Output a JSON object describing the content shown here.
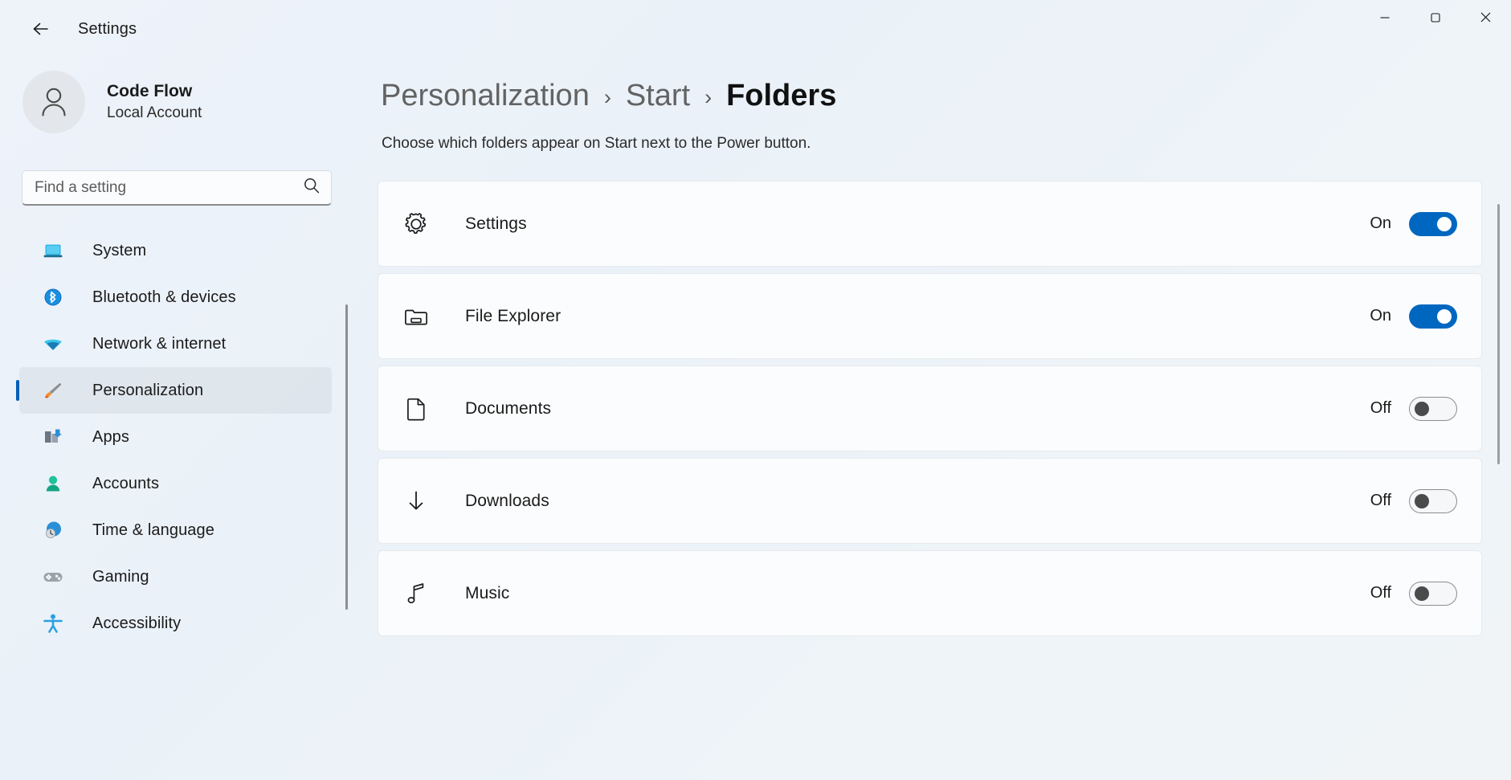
{
  "titlebar": {
    "app_title": "Settings",
    "back_icon": "arrow-left-icon",
    "minimize_icon": "minimize-icon",
    "maximize_icon": "maximize-icon",
    "close_icon": "close-icon"
  },
  "account": {
    "name": "Code Flow",
    "type": "Local Account",
    "avatar_icon": "person-icon"
  },
  "search": {
    "placeholder": "Find a setting",
    "value": "",
    "icon": "search-icon"
  },
  "sidebar": {
    "items": [
      {
        "label": "System",
        "icon": "laptop-icon",
        "selected": false
      },
      {
        "label": "Bluetooth & devices",
        "icon": "bluetooth-icon",
        "selected": false
      },
      {
        "label": "Network & internet",
        "icon": "wifi-icon",
        "selected": false
      },
      {
        "label": "Personalization",
        "icon": "paintbrush-icon",
        "selected": true
      },
      {
        "label": "Apps",
        "icon": "apps-icon",
        "selected": false
      },
      {
        "label": "Accounts",
        "icon": "account-icon",
        "selected": false
      },
      {
        "label": "Time & language",
        "icon": "clock-globe-icon",
        "selected": false
      },
      {
        "label": "Gaming",
        "icon": "gamepad-icon",
        "selected": false
      },
      {
        "label": "Accessibility",
        "icon": "accessibility-icon",
        "selected": false
      }
    ]
  },
  "main": {
    "breadcrumb": [
      {
        "label": "Personalization",
        "current": false
      },
      {
        "label": "Start",
        "current": false
      },
      {
        "label": "Folders",
        "current": true
      }
    ],
    "separator": "›",
    "description": "Choose which folders appear on Start next to the Power button.",
    "folders": [
      {
        "label": "Settings",
        "icon": "gear-icon",
        "state": "On",
        "on": true
      },
      {
        "label": "File Explorer",
        "icon": "folder-icon",
        "state": "On",
        "on": true
      },
      {
        "label": "Documents",
        "icon": "document-icon",
        "state": "Off",
        "on": false
      },
      {
        "label": "Downloads",
        "icon": "download-icon",
        "state": "Off",
        "on": false
      },
      {
        "label": "Music",
        "icon": "music-note-icon",
        "state": "Off",
        "on": false
      }
    ]
  },
  "colors": {
    "accent": "#0067C0",
    "selection_bar": "#005FB8",
    "page_background": "#EEF3FA",
    "card_background": "#FBFCFD"
  }
}
